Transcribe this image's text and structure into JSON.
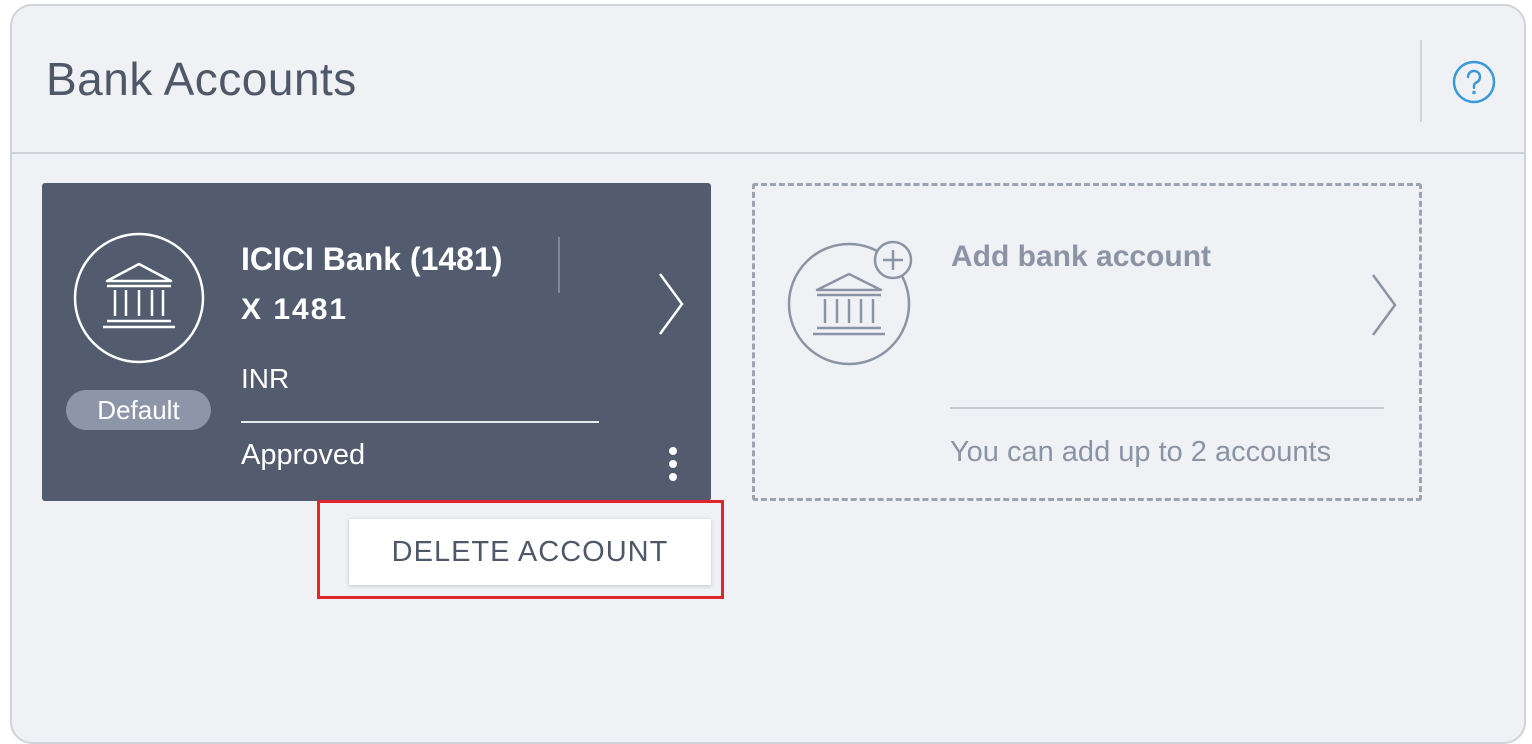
{
  "page": {
    "title": "Bank Accounts",
    "help_icon": "help-circle-icon"
  },
  "account_card": {
    "bank_icon": "bank-icon",
    "name": "ICICI Bank (1481)",
    "masked_number": "X 1481",
    "currency": "INR",
    "status": "Approved",
    "default_badge": "Default",
    "menu_icon": "kebab-menu-icon",
    "chevron_icon": "chevron-right-icon"
  },
  "account_menu": {
    "delete_label": "DELETE ACCOUNT"
  },
  "add_card": {
    "label": "Add bank account",
    "limit_text": "You can add up to 2 accounts",
    "icon": "add-bank-icon",
    "chevron_icon": "chevron-right-icon"
  },
  "colors": {
    "panel_bg": "#eff1f5",
    "card_bg": "#525c6e",
    "accent_blue": "#3a9ad9",
    "highlight_red": "#e0252f",
    "muted_text": "#8b94a4"
  }
}
